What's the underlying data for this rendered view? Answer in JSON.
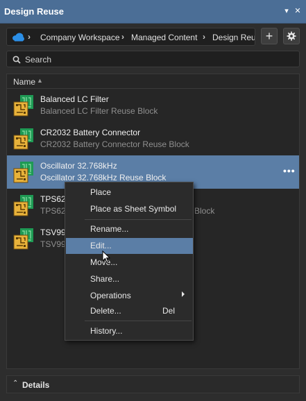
{
  "window": {
    "title": "Design Reuse"
  },
  "titlebar": {
    "dropdown_glyph": "▾",
    "close_glyph": "✕"
  },
  "breadcrumb": {
    "icon": "cloud-icon",
    "items": [
      "Company Workspace",
      "Managed Content",
      "Design Reuse"
    ],
    "separator": "›"
  },
  "toolbar": {
    "add_glyph": "+",
    "settings_icon": "gear-icon"
  },
  "search": {
    "placeholder": "Search",
    "value": ""
  },
  "list": {
    "column": "Name",
    "items": [
      {
        "name": "Balanced LC Filter",
        "description": "Balanced LC Filter Reuse Block",
        "selected": false
      },
      {
        "name": "CR2032 Battery Connector",
        "description": "CR2032 Battery Connector Reuse Block",
        "selected": false
      },
      {
        "name": "Oscillator 32.768kHz",
        "description": "Oscillator 32.768kHz Reuse Block",
        "selected": true,
        "more": "•••"
      },
      {
        "name": "TPS620",
        "description": "TPS620",
        "description_tail": "Block",
        "selected": false
      },
      {
        "name": "TSV991",
        "description": "TSV991",
        "selected": false
      }
    ]
  },
  "context_menu": {
    "items": [
      {
        "label": "Place"
      },
      {
        "label": "Place as Sheet Symbol"
      },
      {
        "label": "Rename..."
      },
      {
        "label": "Edit...",
        "highlighted": true
      },
      {
        "label": "Move..."
      },
      {
        "label": "Share..."
      },
      {
        "label": "Operations",
        "submenu": true
      },
      {
        "label": "Delete...",
        "shortcut": "Del"
      },
      {
        "label": "History..."
      }
    ]
  },
  "details": {
    "label": "Details",
    "chevron": "⌃"
  },
  "colors": {
    "titlebar": "#4b6e96",
    "selection": "#5b7ea6",
    "icon_green": "#1e9a54",
    "icon_yellow": "#e8b23a"
  }
}
